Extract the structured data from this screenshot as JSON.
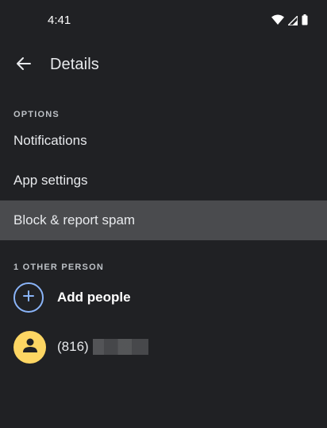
{
  "status_bar": {
    "time": "4:41",
    "icons": [
      "wifi-icon",
      "signal-icon",
      "battery-icon"
    ]
  },
  "app_bar": {
    "back_icon": "arrow-back-icon",
    "title": "Details"
  },
  "options": {
    "header": "OPTIONS",
    "items": [
      {
        "label": "Notifications"
      },
      {
        "label": "App settings"
      },
      {
        "label": "Block & report spam"
      }
    ]
  },
  "people": {
    "header": "1 OTHER PERSON",
    "add_label": "Add people",
    "contact_label": "(816)"
  },
  "colors": {
    "background": "#202124",
    "highlight": "#4a4b4e",
    "accent_blue": "#8ab4f8",
    "avatar_yellow": "#fdd663"
  }
}
